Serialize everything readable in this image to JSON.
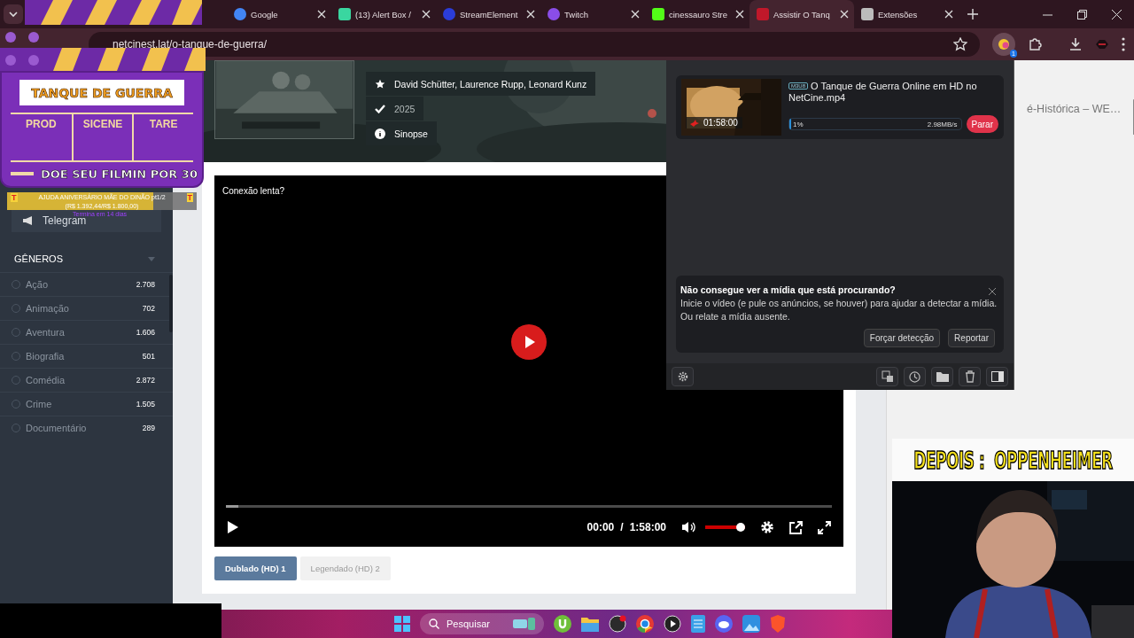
{
  "browser": {
    "tabs": [
      {
        "label": "Google",
        "kind": "google",
        "selected": false
      },
      {
        "label": "(13) Alert Box /",
        "kind": "alert",
        "selected": false
      },
      {
        "label": "StreamElement",
        "kind": "stream",
        "selected": false
      },
      {
        "label": "Twitch",
        "kind": "twitch",
        "selected": false
      },
      {
        "label": "cinessauro Stre",
        "kind": "kick",
        "selected": false
      },
      {
        "label": "Assistir O Tanq",
        "kind": "site",
        "selected": true
      },
      {
        "label": "Extensões",
        "kind": "puzzle",
        "selected": false
      }
    ],
    "url": "netcinest.lat/o-tanque-de-guerra/",
    "extension_badge": "1"
  },
  "overlay": {
    "clapboard": {
      "title": "TANQUE DE GUERRA",
      "columns": [
        "PROD",
        "SICENE",
        "TARE"
      ],
      "footer": "DOE SEU FILMIN POR 30"
    },
    "goal": {
      "badge_left": "T",
      "title": "AJUDA ANIVERSÁRIO MÃE DO DINÃO pt1/2",
      "badge_right": "T",
      "amount": "(R$ 1.392,44/R$ 1.800,00)",
      "ends": "Termina em 14 dias",
      "level": 0.77
    },
    "next_banner": "DEPOIS :  OPPENHEIMER"
  },
  "sidebar": {
    "link": "Telegram",
    "genres_title": "GÊNEROS",
    "genres": [
      {
        "name": "Ação",
        "count": "2.708",
        "selected": false
      },
      {
        "name": "Animação",
        "count": "702",
        "selected": false
      },
      {
        "name": "Aventura",
        "count": "1.606",
        "selected": false
      },
      {
        "name": "Biografia",
        "count": "501",
        "selected": false
      },
      {
        "name": "Comédia",
        "count": "2.872",
        "selected": false
      },
      {
        "name": "Crime",
        "count": "1.505",
        "selected": false
      },
      {
        "name": "Documentário",
        "count": "289",
        "selected": false
      }
    ]
  },
  "movie": {
    "cast": "David Schütter, Laurence Rupp, Leonard Kunz",
    "year": "2025",
    "synopsis": "Sinopse"
  },
  "player": {
    "notice": "Conexão lenta?",
    "level": 0.02,
    "current": "00:00",
    "separator": "/",
    "duration": "1:58:00",
    "volume": {
      "level": 1
    }
  },
  "sources": [
    {
      "label": "Dublado (HD) 1",
      "selected": true
    },
    {
      "label": "Legendado (HD) 2",
      "selected": false
    }
  ],
  "aside": {
    "text": "é-Histórica – WE…"
  },
  "downloader": {
    "item": {
      "badge": "M3U8",
      "title": "O Tanque de Guerra Online em HD no NetCine.mp4",
      "duration": "01:58:00",
      "percent": "1%",
      "level": 0.01,
      "speed": "2.98MB/s",
      "stop": "Parar"
    },
    "notice": {
      "title": "Não consegue ver a mídia que está procurando?",
      "lines": [
        "Inicie o vídeo (e pule os anúncios, se houver) para ajudar a detectar a mídia.",
        "Ou relate a mídia ausente."
      ],
      "buttons": [
        "Forçar detecção",
        "Reportar"
      ]
    }
  },
  "taskbar": {
    "search": "Pesquisar"
  }
}
